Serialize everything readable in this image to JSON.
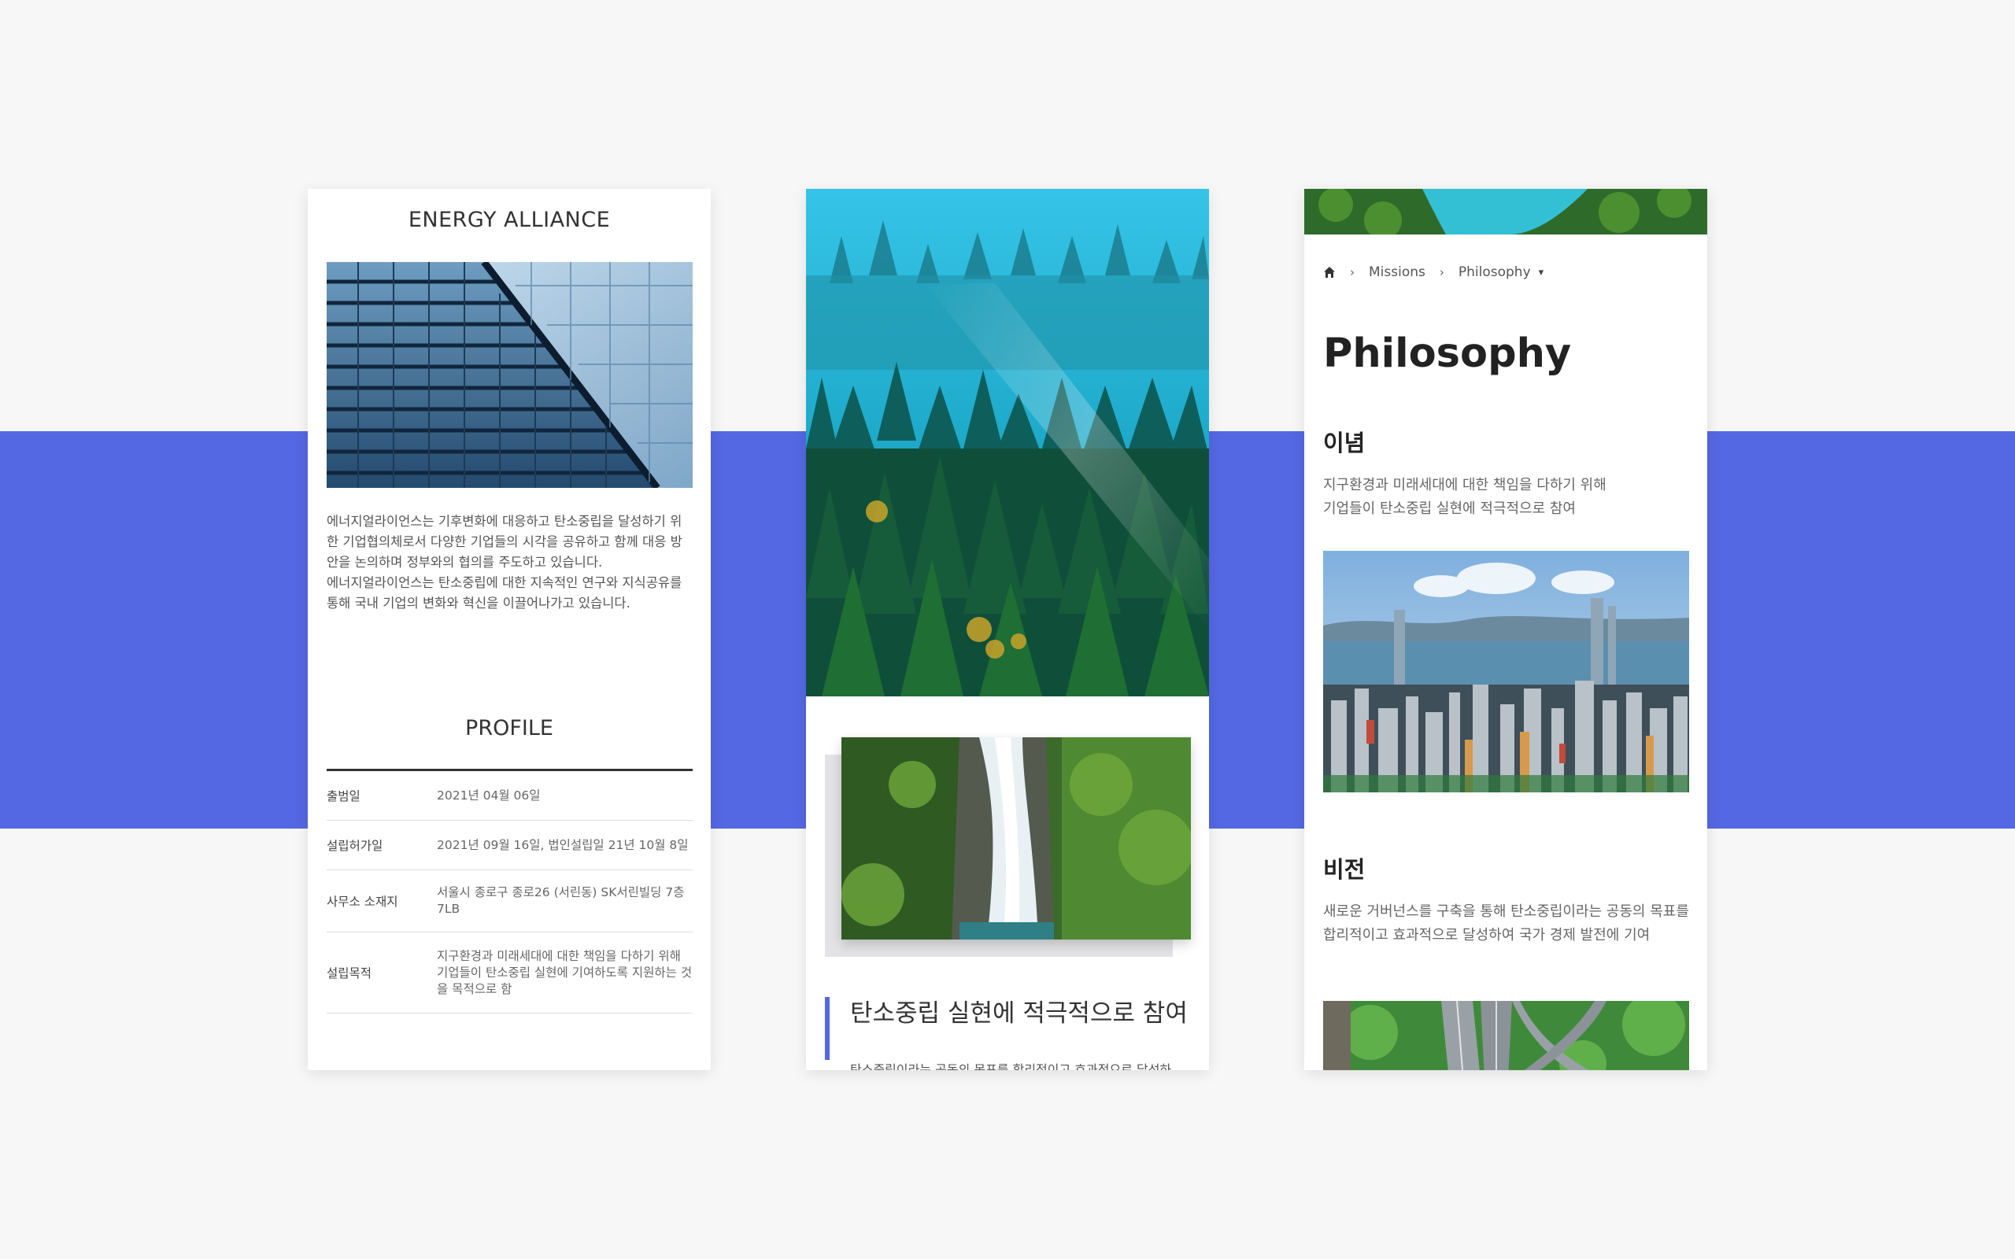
{
  "card1": {
    "title": "ENERGY ALLIANCE",
    "intro_1": "에너지얼라이언스는 기후변화에 대응하고 탄소중립을 달성하기 위한 기업협의체로서 다양한 기업들의 시각을 공유하고 함께 대응 방안을 논의하며 정부와의 협의를 주도하고 있습니다.",
    "intro_2": "에너지얼라이언스는 탄소중립에 대한 지속적인 연구와 지식공유를 통해 국내 기업의 변화와 혁신을 이끌어나가고 있습니다.",
    "profile_title": "PROFILE",
    "profile_rows": [
      {
        "label": "출범일",
        "value": "2021년 04월 06일"
      },
      {
        "label": "설립허가일",
        "value": "2021년 09월 16일, 법인설립일 21년 10월 8일"
      },
      {
        "label": "사무소 소재지",
        "value": "서울시 종로구 종로26 (서린동) SK서린빌딩 7층 7LB"
      },
      {
        "label": "설립목적",
        "value": "지구환경과 미래세대에 대한 책임을 다하기 위해 기업들이 탄소중립 실현에 기여하도록 지원하는 것을 목적으로 함"
      }
    ]
  },
  "card2": {
    "headline": "탄소중립 실현에 적극적으로 참여",
    "body": "탄소중립이라는 공동의 목표를 합리적이고 효과적으로 달성하"
  },
  "card3": {
    "breadcrumb": {
      "home_icon": "home-icon",
      "item1": "Missions",
      "item2": "Philosophy",
      "separator": "›",
      "caret": "▾"
    },
    "title": "Philosophy",
    "section1_title": "이념",
    "section1_line1": "지구환경과 미래세대에 대한 책임을 다하기 위해",
    "section1_line2": "기업들이 탄소중립 실현에 적극적으로 참여",
    "section2_title": "비전",
    "section2_line1": "새로운 거버넌스를 구축을 통해 탄소중립이라는 공동의 목표를",
    "section2_line2": "합리적이고 효과적으로 달성하여 국가 경제 발전에 기여"
  },
  "colors": {
    "accent": "#5468e3",
    "background": "#f7f7f8",
    "card": "#ffffff"
  }
}
